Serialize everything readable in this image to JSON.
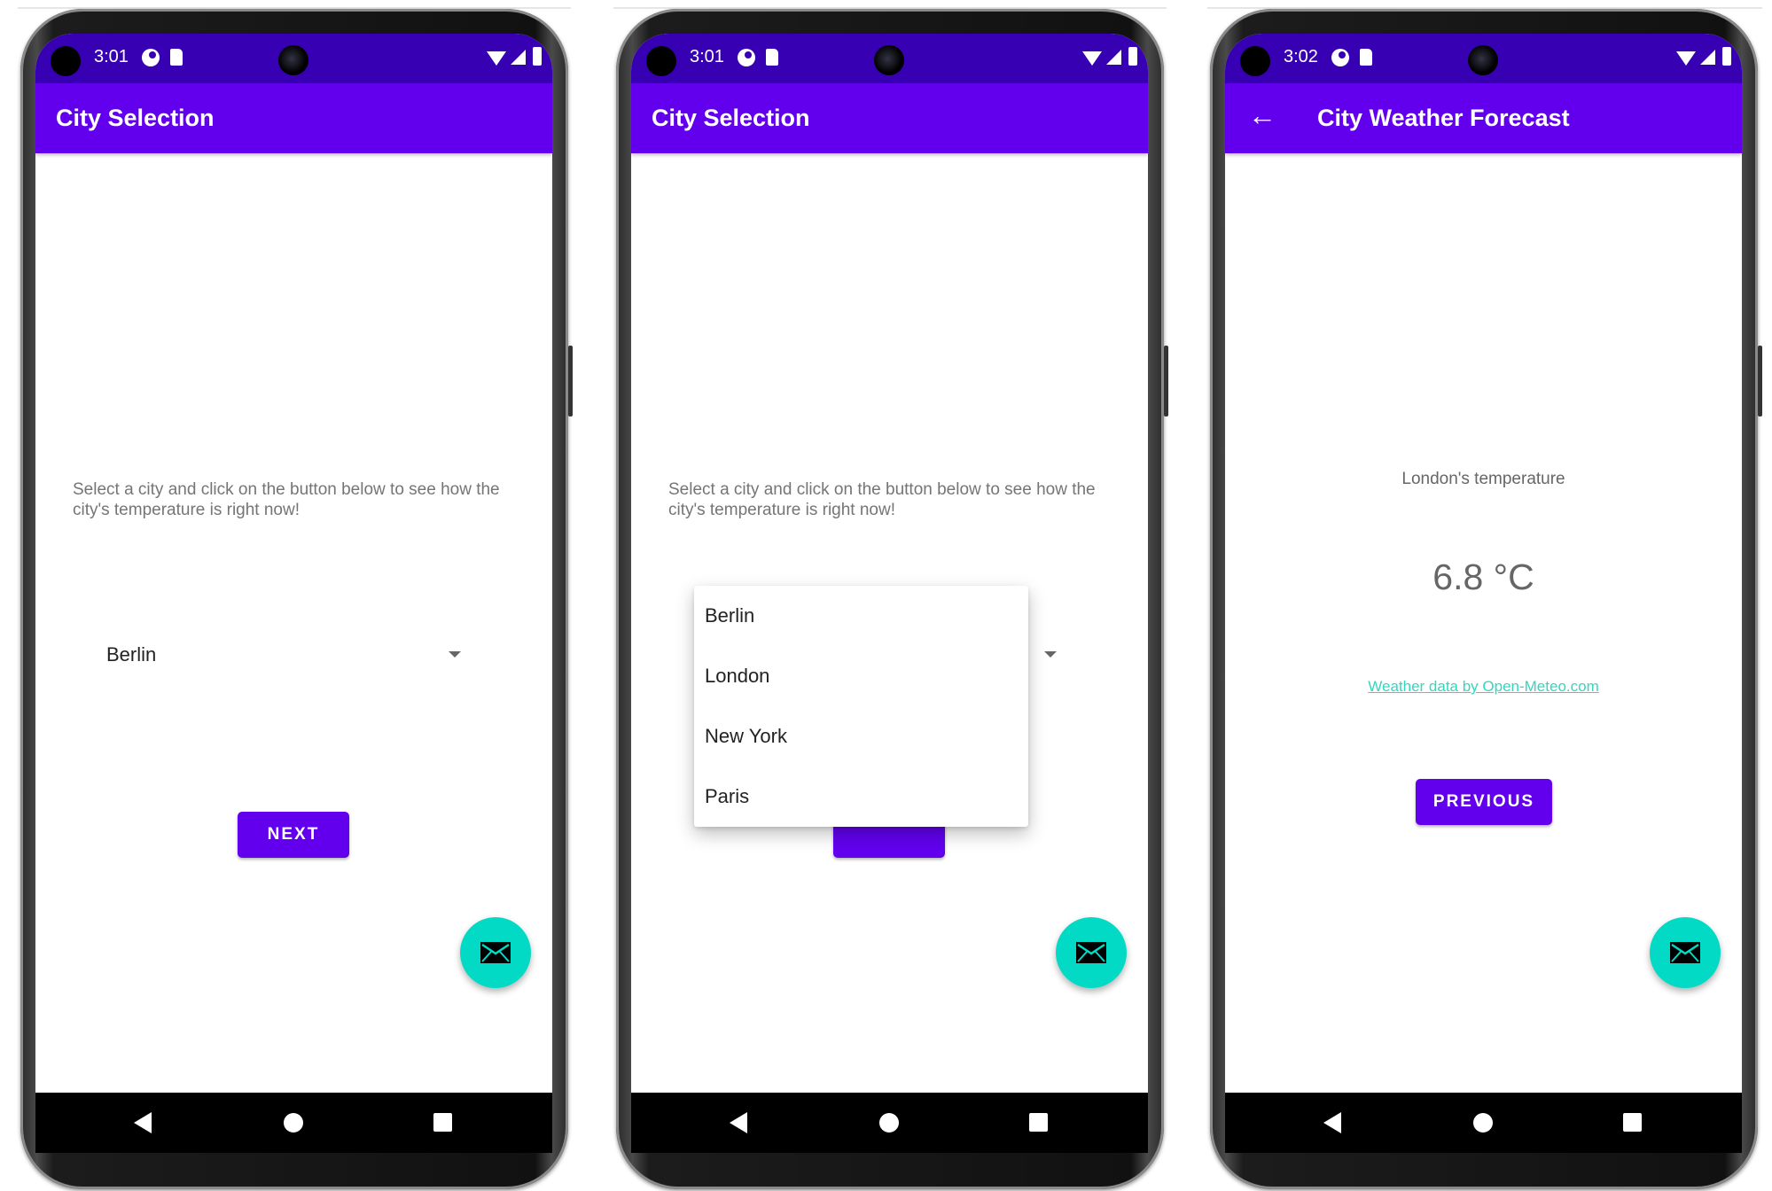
{
  "colors": {
    "primary": "#6200EE",
    "primary_dark": "#3700B3",
    "accent": "#03DAC5",
    "link": "#34D6C0"
  },
  "screens": [
    {
      "status": {
        "time": "3:01"
      },
      "appbar": {
        "title": "City Selection"
      },
      "intro": "Select a city and click on the button below to see how the city's temperature is right now!",
      "spinner": {
        "selected": "Berlin"
      },
      "next_label": "NEXT",
      "fab_icon": "email-icon"
    },
    {
      "status": {
        "time": "3:01"
      },
      "appbar": {
        "title": "City Selection"
      },
      "intro": "Select a city and click on the button below to see how the city's temperature is right now!",
      "dropdown": {
        "options": [
          "Berlin",
          "London",
          "New York",
          "Paris"
        ]
      },
      "fab_icon": "email-icon"
    },
    {
      "status": {
        "time": "3:02"
      },
      "appbar": {
        "title": "City Weather Forecast",
        "back_icon": "arrow-back-icon"
      },
      "temperature_label": "London's temperature",
      "temperature_value": "6.8 °C",
      "attribution_link": "Weather data by Open-Meteo.com",
      "previous_label": "PREVIOUS",
      "fab_icon": "email-icon"
    }
  ]
}
